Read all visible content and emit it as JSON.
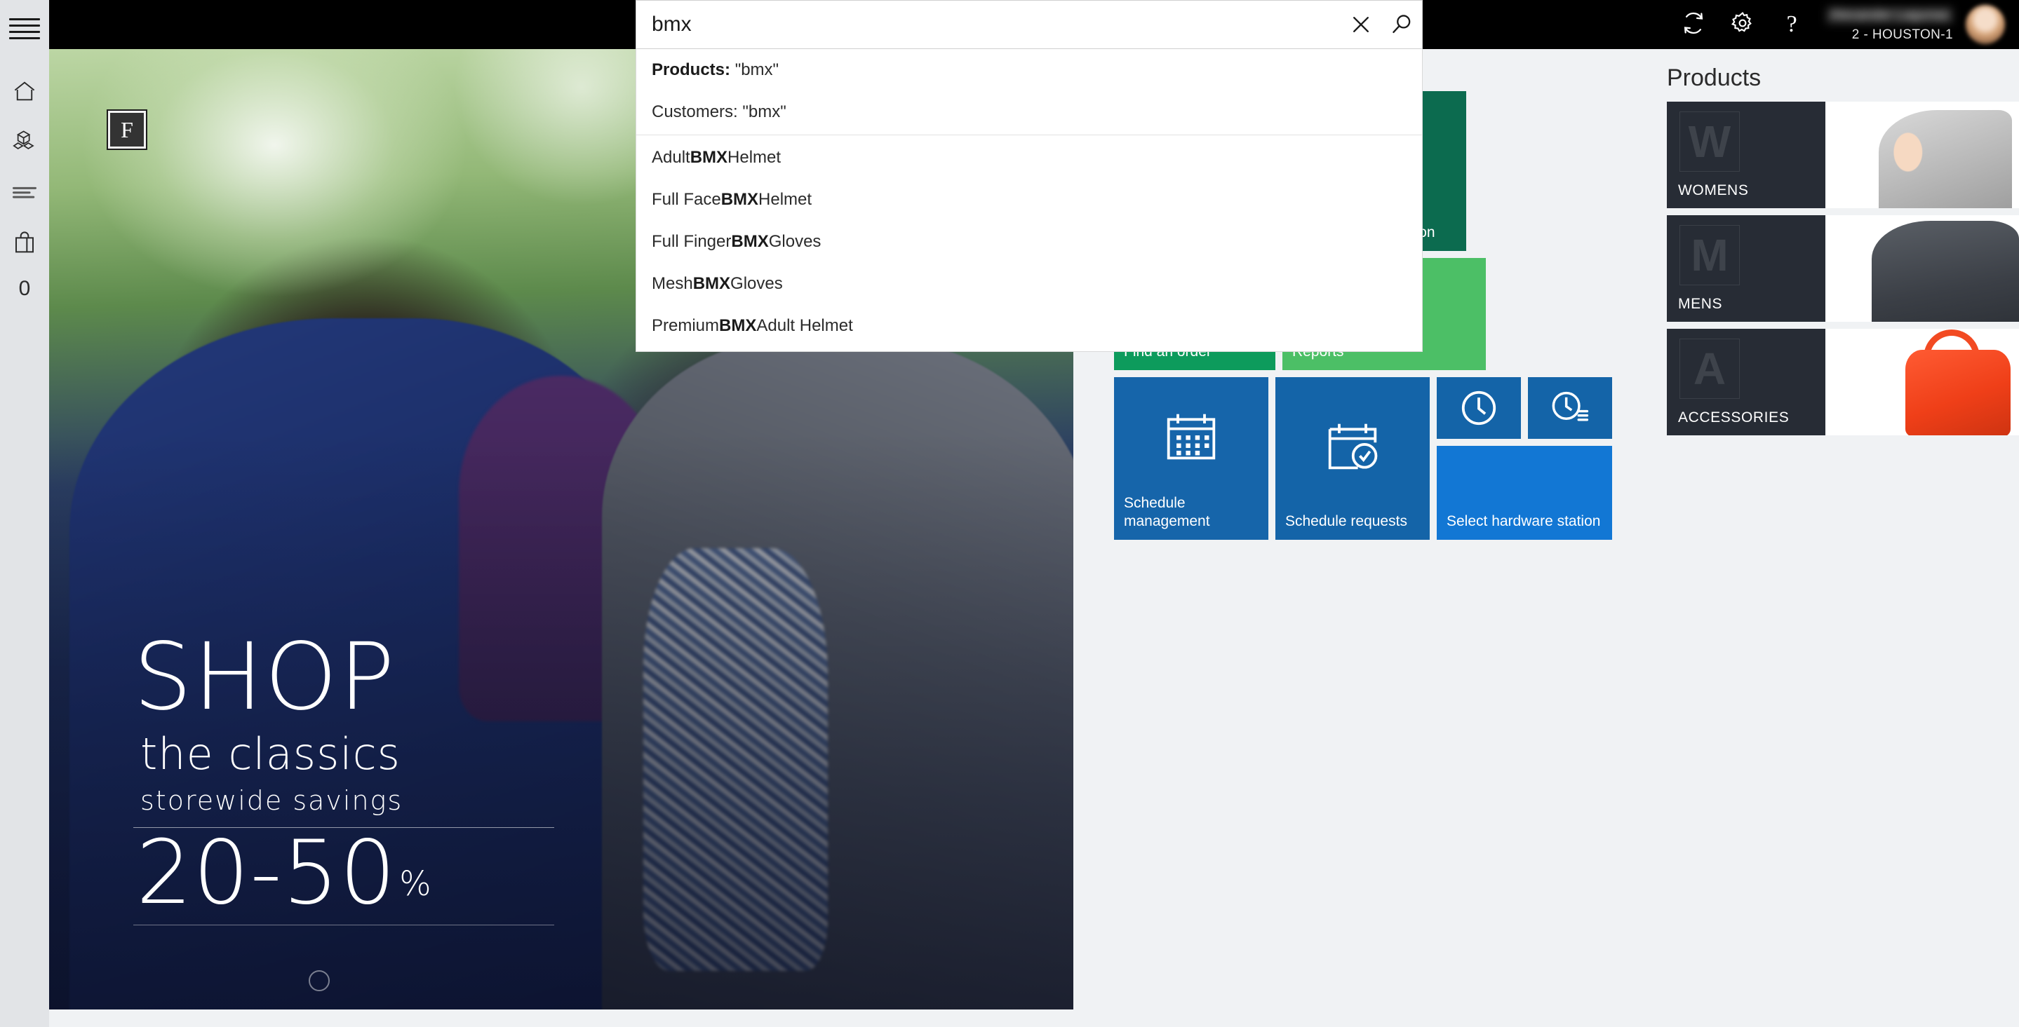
{
  "app": {
    "left_rail": {
      "menu_icon": "hamburger-menu-icon",
      "items": [
        {
          "icon": "home-icon",
          "name": "home"
        },
        {
          "icon": "products-cubes-icon",
          "name": "products"
        },
        {
          "icon": "list-lines-icon",
          "name": "transactions"
        },
        {
          "icon": "shopping-bag-icon",
          "name": "cart"
        }
      ],
      "cart_count": "0"
    },
    "topbar": {
      "sync_icon": "refresh-sync-icon",
      "settings_icon": "gear-icon",
      "help_icon": "question-mark-icon",
      "help_label": "?",
      "user_name": "Alexander Lagunas",
      "user_store": "2 - HOUSTON-1",
      "avatar_icon": "user-avatar"
    },
    "search": {
      "value": "bmx",
      "placeholder": "Search",
      "clear_icon": "close-x-icon",
      "search_icon": "magnifier-search-icon",
      "scopes": [
        {
          "label": "Products:",
          "query": "\"bmx\"",
          "bold": true
        },
        {
          "label": "Customers:",
          "query": "\"bmx\"",
          "bold": false
        }
      ],
      "results": [
        {
          "pre": "Adult ",
          "match": "BMX",
          "post": " Helmet"
        },
        {
          "pre": "Full Face ",
          "match": "BMX",
          "post": " Helmet"
        },
        {
          "pre": "Full Finger ",
          "match": "BMX",
          "post": " Gloves"
        },
        {
          "pre": "Mesh ",
          "match": "BMX",
          "post": " Gloves"
        },
        {
          "pre": "Premium ",
          "match": "BMX",
          "post": " Adult Helmet"
        }
      ]
    },
    "hero": {
      "logo_letter": "F",
      "line1": "SHOP",
      "line2": "the classics",
      "line3": "storewide  savings",
      "discount": "20-50",
      "percent": "%"
    },
    "tiles": [
      {
        "label": "",
        "icon": "cart-icon",
        "color": "#0d7a4b",
        "size": "hidden-left",
        "name": "current-transaction"
      },
      {
        "label": "Return transaction",
        "icon": "cart-return-icon",
        "color": "#0c6b4f",
        "size": "lg",
        "name": "return-transaction"
      },
      {
        "label": "Find an order",
        "icon": "order-search-icon",
        "color": "#0d9b5c",
        "size": "md",
        "name": "find-an-order"
      },
      {
        "label": "Reports",
        "icon": "chart-up-icon",
        "color": "#4cbf66",
        "size": "wide",
        "name": "reports"
      },
      {
        "label": "Schedule management",
        "icon": "calendar-icon",
        "color": "#1665aa",
        "size": "md",
        "name": "schedule-management"
      },
      {
        "label": "Schedule requests",
        "icon": "calendar-check-icon",
        "color": "#1464a8",
        "size": "md",
        "name": "schedule-requests"
      },
      {
        "label": "",
        "icon": "clock-icon",
        "color": "#1464a8",
        "size": "sm",
        "name": "time-clock"
      },
      {
        "label": "",
        "icon": "clock-list-icon",
        "color": "#1464a8",
        "size": "sm",
        "name": "time-clock-entries"
      },
      {
        "label": "Select hardware station",
        "icon": "",
        "color": "#1277d4",
        "size": "hw",
        "name": "select-hardware-station"
      }
    ],
    "products": {
      "title": "Products",
      "cards": [
        {
          "letter": "W",
          "label": "WOMENS",
          "image": "woman-in-grey-blazer"
        },
        {
          "letter": "M",
          "label": "MENS",
          "image": "man-in-dark-suit"
        },
        {
          "letter": "A",
          "label": "ACCESSORIES",
          "image": "orange-handbag"
        }
      ]
    }
  }
}
